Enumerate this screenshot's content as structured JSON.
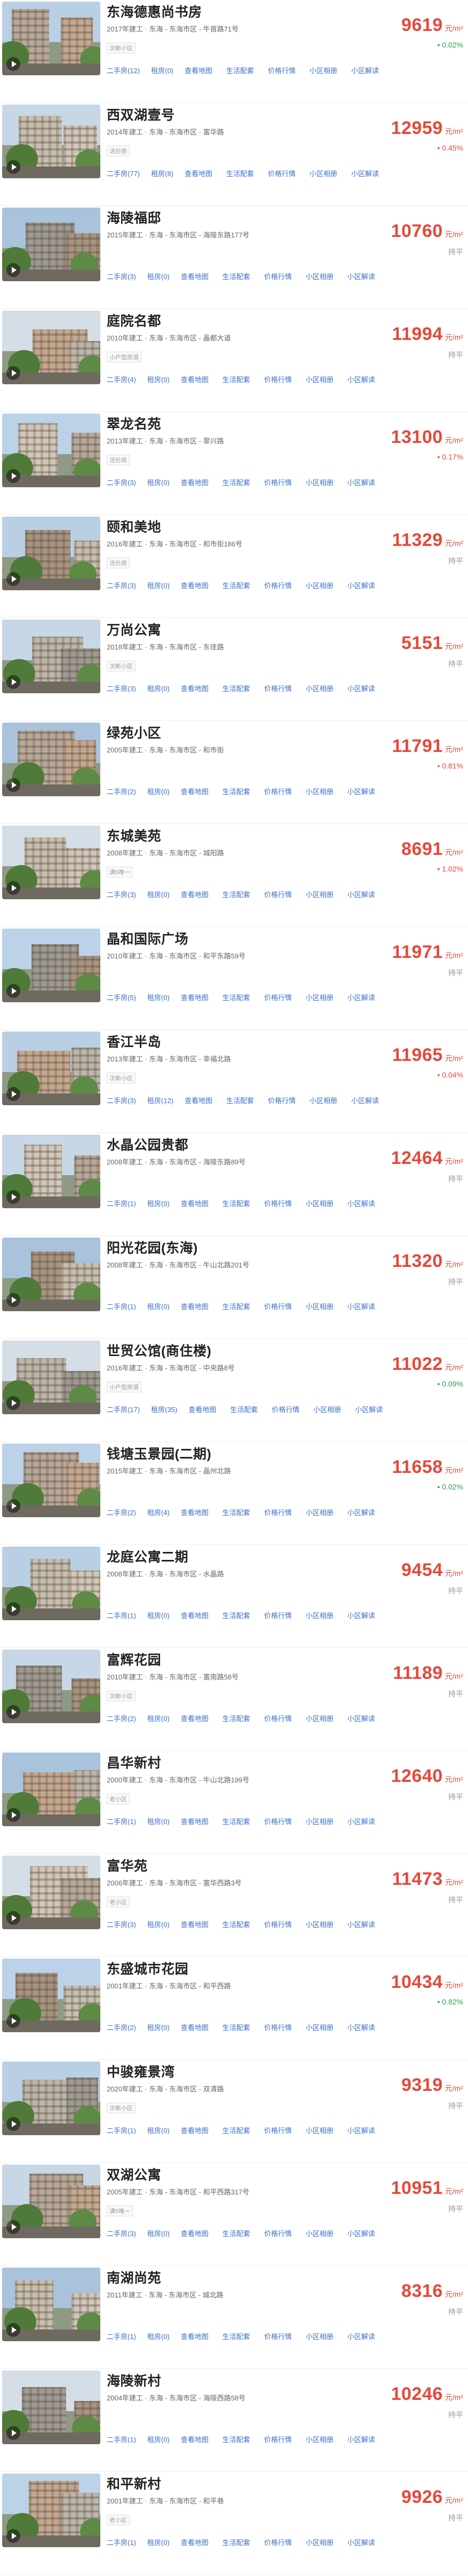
{
  "price_unit": "元/m²",
  "colors": {
    "price": "#e6483a",
    "link": "#3a6fcb",
    "up": "#e6483a",
    "down": "#2e9a55"
  },
  "communities": [
    {
      "name": "东海德惠尚书房",
      "meta": "2017年建工 · 东海 - 东海市区 - 牛首路71号",
      "tag": "次新小区",
      "price": "9619",
      "change": "• 0.02%",
      "trend": "down",
      "links": [
        "二手房(12)",
        "租房(0)",
        "查看地图",
        "生活配套",
        "价格行情",
        "小区相册",
        "小区解读"
      ]
    },
    {
      "name": "西双湖壹号",
      "meta": "2014年建工 · 东海 - 东海市区 - 富华路",
      "tag": "活价房",
      "price": "12959",
      "change": "• 0.45%",
      "trend": "up",
      "links": [
        "二手房(77)",
        "租房(8)",
        "查看地图",
        "生活配套",
        "价格行情",
        "小区相册",
        "小区解读"
      ]
    },
    {
      "name": "海陵福邸",
      "meta": "2015年建工 · 东海 - 东海市区 - 海陵东路177号",
      "tag": "",
      "price": "10760",
      "change": "持平",
      "trend": "flat",
      "links": [
        "二手房(3)",
        "租房(0)",
        "查看地图",
        "生活配套",
        "价格行情",
        "小区相册",
        "小区解读"
      ]
    },
    {
      "name": "庭院名都",
      "meta": "2010年建工 · 东海 - 东海市区 - 晶都大道",
      "tag": "小户型房源",
      "price": "11994",
      "change": "持平",
      "trend": "flat",
      "links": [
        "二手房(4)",
        "租房(0)",
        "查看地图",
        "生活配套",
        "价格行情",
        "小区相册",
        "小区解读"
      ]
    },
    {
      "name": "翠龙名苑",
      "meta": "2013年建工 · 东海 - 东海市区 - 翠兴路",
      "tag": "活价房",
      "price": "13100",
      "change": "• 0.17%",
      "trend": "up",
      "links": [
        "二手房(3)",
        "租房(0)",
        "查看地图",
        "生活配套",
        "价格行情",
        "小区相册",
        "小区解读"
      ]
    },
    {
      "name": "颐和美地",
      "meta": "2016年建工 · 东海 - 东海市区 - 和市街186号",
      "tag": "活价房",
      "price": "11329",
      "change": "持平",
      "trend": "flat",
      "links": [
        "二手房(3)",
        "租房(0)",
        "查看地图",
        "生活配套",
        "价格行情",
        "小区相册",
        "小区解读"
      ]
    },
    {
      "name": "万尚公寓",
      "meta": "2018年建工 · 东海 - 东海市区 - 东佳路",
      "tag": "次新小区",
      "price": "5151",
      "change": "持平",
      "trend": "flat",
      "links": [
        "二手房(3)",
        "租房(0)",
        "查看地图",
        "生活配套",
        "价格行情",
        "小区相册",
        "小区解读"
      ]
    },
    {
      "name": "绿苑小区",
      "meta": "2005年建工 · 东海 - 东海市区 - 和市街",
      "tag": "",
      "price": "11791",
      "change": "• 0.81%",
      "trend": "up",
      "links": [
        "二手房(2)",
        "租房(0)",
        "查看地图",
        "生活配套",
        "价格行情",
        "小区相册",
        "小区解读"
      ]
    },
    {
      "name": "东城美苑",
      "meta": "2008年建工 · 东海 - 东海市区 - 城阳路",
      "tag": "满5唯一",
      "price": "8691",
      "change": "• 1.02%",
      "trend": "up",
      "links": [
        "二手房(3)",
        "租房(0)",
        "查看地图",
        "生活配套",
        "价格行情",
        "小区相册",
        "小区解读"
      ]
    },
    {
      "name": "晶和国际广场",
      "meta": "2010年建工 · 东海 - 东海市区 - 和平东路59号",
      "tag": "",
      "price": "11971",
      "change": "持平",
      "trend": "flat",
      "links": [
        "二手房(5)",
        "租房(0)",
        "查看地图",
        "生活配套",
        "价格行情",
        "小区相册",
        "小区解读"
      ]
    },
    {
      "name": "香江半岛",
      "meta": "2013年建工 · 东海 - 东海市区 - 幸福北路",
      "tag": "次新小区",
      "price": "11965",
      "change": "• 0.04%",
      "trend": "up",
      "links": [
        "二手房(3)",
        "租房(12)",
        "查看地图",
        "生活配套",
        "价格行情",
        "小区相册",
        "小区解读"
      ]
    },
    {
      "name": "水晶公园贵都",
      "meta": "2008年建工 · 东海 - 东海市区 - 海陵东路89号",
      "tag": "",
      "price": "12464",
      "change": "持平",
      "trend": "flat",
      "links": [
        "二手房(1)",
        "租房(0)",
        "查看地图",
        "生活配套",
        "价格行情",
        "小区相册",
        "小区解读"
      ]
    },
    {
      "name": "阳光花园(东海)",
      "meta": "2008年建工 · 东海 - 东海市区 - 牛山北路201号",
      "tag": "",
      "price": "11320",
      "change": "持平",
      "trend": "flat",
      "links": [
        "二手房(1)",
        "租房(0)",
        "查看地图",
        "生活配套",
        "价格行情",
        "小区相册",
        "小区解读"
      ]
    },
    {
      "name": "世贸公馆(商住楼)",
      "meta": "2016年建工 · 东海 - 东海市区 - 中央路8号",
      "tag": "小户型房源",
      "price": "11022",
      "change": "• 0.09%",
      "trend": "down",
      "links": [
        "二手房(17)",
        "租房(35)",
        "查看地图",
        "生活配套",
        "价格行情",
        "小区相册",
        "小区解读"
      ]
    },
    {
      "name": "钱塘玉景园(二期)",
      "meta": "2015年建工 · 东海 - 东海市区 - 晶州北路",
      "tag": "",
      "price": "11658",
      "change": "• 0.02%",
      "trend": "down",
      "links": [
        "二手房(2)",
        "租房(4)",
        "查看地图",
        "生活配套",
        "价格行情",
        "小区相册",
        "小区解读"
      ]
    },
    {
      "name": "龙庭公寓二期",
      "meta": "2008年建工 · 东海 - 东海市区 - 水晶路",
      "tag": "",
      "price": "9454",
      "change": "持平",
      "trend": "flat",
      "links": [
        "二手房(1)",
        "租房(0)",
        "查看地图",
        "生活配套",
        "价格行情",
        "小区相册",
        "小区解读"
      ]
    },
    {
      "name": "富辉花园",
      "meta": "2010年建工 · 东海 - 东海市区 - 富南路58号",
      "tag": "次新小区",
      "price": "11189",
      "change": "持平",
      "trend": "flat",
      "links": [
        "二手房(2)",
        "租房(0)",
        "查看地图",
        "生活配套",
        "价格行情",
        "小区相册",
        "小区解读"
      ]
    },
    {
      "name": "昌华新村",
      "meta": "2000年建工 · 东海 - 东海市区 - 牛山北路199号",
      "tag": "老小区",
      "price": "12640",
      "change": "持平",
      "trend": "flat",
      "links": [
        "二手房(1)",
        "租房(0)",
        "查看地图",
        "生活配套",
        "价格行情",
        "小区相册",
        "小区解读"
      ]
    },
    {
      "name": "富华苑",
      "meta": "2006年建工 · 东海 - 东海市区 - 富华西路3号",
      "tag": "老小区",
      "price": "11473",
      "change": "持平",
      "trend": "flat",
      "links": [
        "二手房(3)",
        "租房(0)",
        "查看地图",
        "生活配套",
        "价格行情",
        "小区相册",
        "小区解读"
      ]
    },
    {
      "name": "东盛城市花园",
      "meta": "2001年建工 · 东海 - 东海市区 - 和平西路",
      "tag": "",
      "price": "10434",
      "change": "• 0.82%",
      "trend": "down",
      "links": [
        "二手房(2)",
        "租房(0)",
        "查看地图",
        "生活配套",
        "价格行情",
        "小区相册",
        "小区解读"
      ]
    },
    {
      "name": "中骏雍景湾",
      "meta": "2020年建工 · 东海 - 东海市区 - 双清路",
      "tag": "次新小区",
      "price": "9319",
      "change": "持平",
      "trend": "flat",
      "links": [
        "二手房(1)",
        "租房(0)",
        "查看地图",
        "生活配套",
        "价格行情",
        "小区相册",
        "小区解读"
      ]
    },
    {
      "name": "双湖公寓",
      "meta": "2005年建工 · 东海 - 东海市区 - 和平西路317号",
      "tag": "满5唯一",
      "price": "10951",
      "change": "持平",
      "trend": "flat",
      "links": [
        "二手房(3)",
        "租房(0)",
        "查看地图",
        "生活配套",
        "价格行情",
        "小区相册",
        "小区解读"
      ]
    },
    {
      "name": "南湖尚苑",
      "meta": "2011年建工 · 东海 - 东海市区 - 城北路",
      "tag": "",
      "price": "8316",
      "change": "持平",
      "trend": "flat",
      "links": [
        "二手房(1)",
        "租房(0)",
        "查看地图",
        "生活配套",
        "价格行情",
        "小区相册",
        "小区解读"
      ]
    },
    {
      "name": "海陵新村",
      "meta": "2004年建工 · 东海 - 东海市区 - 海陵西路58号",
      "tag": "",
      "price": "10246",
      "change": "持平",
      "trend": "flat",
      "links": [
        "二手房(1)",
        "租房(0)",
        "查看地图",
        "生活配套",
        "价格行情",
        "小区相册",
        "小区解读"
      ]
    },
    {
      "name": "和平新村",
      "meta": "2001年建工 · 东海 - 东海市区 - 和平巷",
      "tag": "老小区",
      "price": "9926",
      "change": "持平",
      "trend": "flat",
      "links": [
        "二手房(1)",
        "租房(0)",
        "查看地图",
        "生活配套",
        "价格行情",
        "小区相册",
        "小区解读"
      ]
    }
  ]
}
